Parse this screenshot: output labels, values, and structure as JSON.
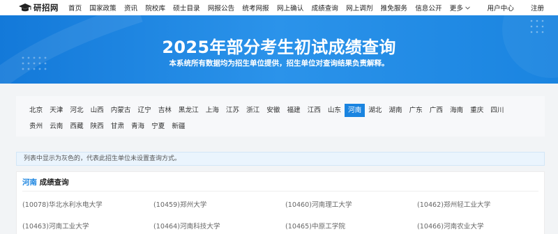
{
  "logo": {
    "text": "研招网",
    "icon": "graduation-cap-icon"
  },
  "nav": {
    "links": [
      "首页",
      "国家政策",
      "资讯",
      "院校库",
      "硕士目录",
      "网报公告",
      "统考网报",
      "网上确认",
      "成绩查询",
      "网上调剂",
      "推免服务",
      "信息公开"
    ],
    "more": "更多",
    "right": [
      "用户中心",
      "注册"
    ]
  },
  "banner": {
    "title": "2025年部分考生初试成绩查询",
    "subtitle": "本系统所有数据均为招生单位提供，招生单位对查询结果负责解释。",
    "background": "#1a84e0"
  },
  "provinces": {
    "row1": [
      "北京",
      "天津",
      "河北",
      "山西",
      "内蒙古",
      "辽宁",
      "吉林",
      "黑龙江",
      "上海",
      "江苏",
      "浙江",
      "安徽",
      "福建",
      "江西",
      "山东",
      "河南",
      "湖北",
      "湖南",
      "广东",
      "广西",
      "海南",
      "重庆",
      "四川"
    ],
    "row2": [
      "贵州",
      "云南",
      "西藏",
      "陕西",
      "甘肃",
      "青海",
      "宁夏",
      "新疆"
    ],
    "selected": "河南",
    "accent": "#1a84e0"
  },
  "notice": "列表中显示为灰色的，代表此招生单位未设置查询方式。",
  "results": {
    "province": "河南",
    "title_suffix": " 成绩查询",
    "universities": [
      "(10078)华北水利水电大学",
      "(10459)郑州大学",
      "(10460)河南理工大学",
      "(10462)郑州轻工业大学",
      "(10463)河南工业大学",
      "(10464)河南科技大学",
      "(10465)中原工学院",
      "(10466)河南农业大学"
    ]
  }
}
